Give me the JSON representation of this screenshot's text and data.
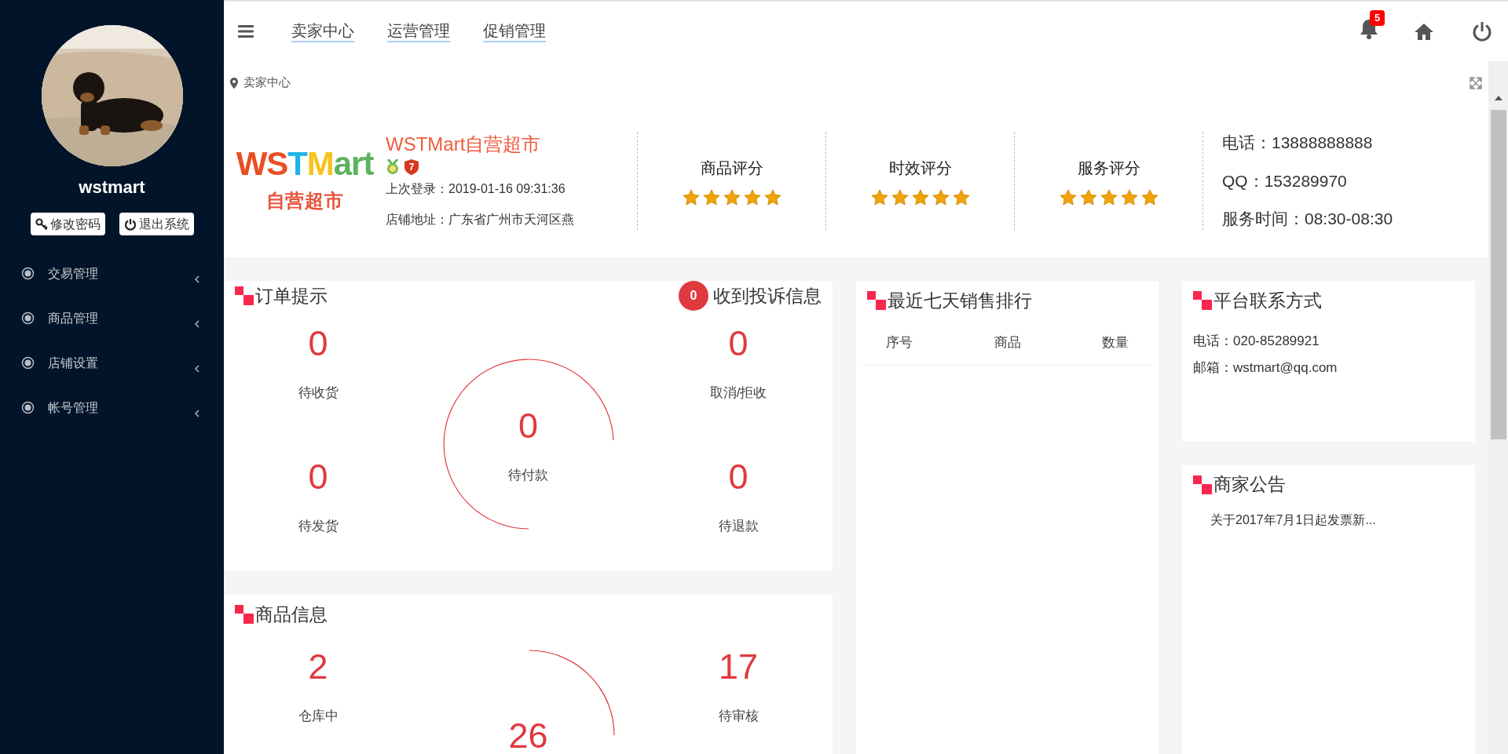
{
  "sidebar": {
    "user_name": "wstmart",
    "buttons": [
      {
        "kind": "key",
        "label": "修改密码"
      },
      {
        "kind": "power",
        "label": "退出系统"
      }
    ],
    "items": [
      {
        "label": "交易管理",
        "expanded": false
      },
      {
        "label": "商品管理",
        "expanded": false
      },
      {
        "label": "店铺设置",
        "expanded": false
      },
      {
        "label": "帐号管理",
        "expanded": false
      }
    ]
  },
  "top_nav": {
    "tabs": [
      "卖家中心",
      "运营管理",
      "促销管理"
    ],
    "notification_count": "5"
  },
  "breadcrumb": "卖家中心",
  "store": {
    "logo": {
      "text": "WSTMart",
      "subtitle": "自营超市"
    },
    "name": "WSTMart自营超市",
    "badge_number": "7",
    "last_login": "上次登录：2019-01-16 09:31:36",
    "address": "店铺地址：广东省广州市天河区燕",
    "ratings": [
      {
        "label": "商品评分",
        "stars": 5
      },
      {
        "label": "时效评分",
        "stars": 5
      },
      {
        "label": "服务评分",
        "stars": 5
      }
    ],
    "contact": [
      "电话：13888888888",
      "QQ：153289970",
      "服务时间：08:30-08:30"
    ]
  },
  "order_panel": {
    "title": "订单提示",
    "complaint_count": "0",
    "complaint_label": "收到投诉信息",
    "left": [
      {
        "value": "0",
        "label": "待收货"
      },
      {
        "value": "0",
        "label": "待发货"
      }
    ],
    "center": {
      "value": "0",
      "label": "待付款"
    },
    "right": [
      {
        "value": "0",
        "label": "取消/拒收"
      },
      {
        "value": "0",
        "label": "待退款"
      }
    ]
  },
  "goods_panel": {
    "title": "商品信息",
    "left": [
      {
        "value": "2",
        "label": "仓库中"
      }
    ],
    "center": {
      "value": "26"
    },
    "right": [
      {
        "value": "17",
        "label": "待审核"
      }
    ]
  },
  "sales_panel": {
    "title": "最近七天销售排行",
    "columns": [
      "序号",
      "商品",
      "数量"
    ]
  },
  "contact_panel": {
    "title": "平台联系方式",
    "lines": [
      "电话：020-85289921",
      "邮箱：wstmart@qq.com"
    ]
  },
  "notice_panel": {
    "title": "商家公告",
    "items": [
      "关于2017年7月1日起发票新..."
    ]
  }
}
